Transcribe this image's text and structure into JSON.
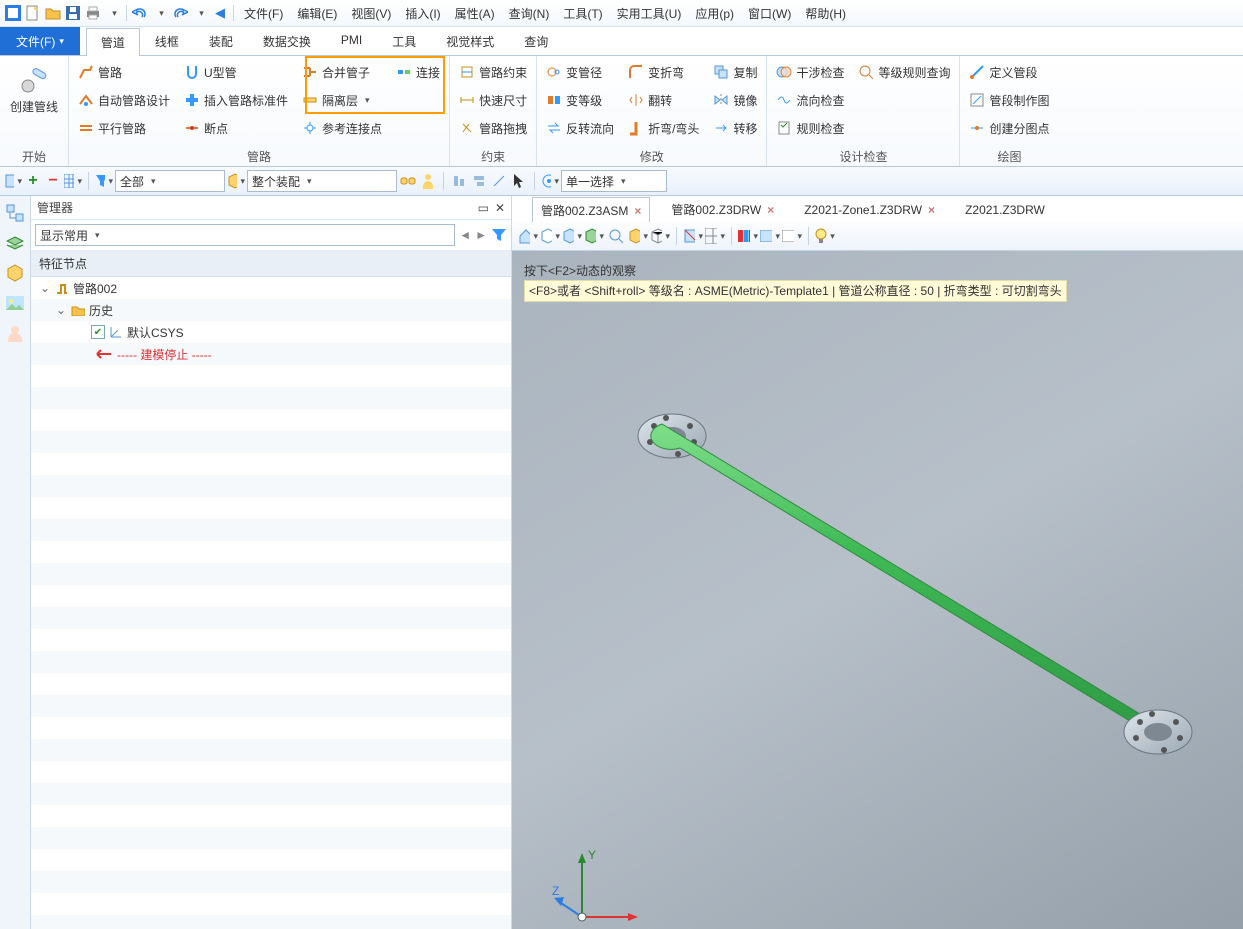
{
  "qa_menus": [
    "文件(F)",
    "编辑(E)",
    "视图(V)",
    "插入(I)",
    "属性(A)",
    "查询(N)",
    "工具(T)",
    "实用工具(U)",
    "应用(p)",
    "窗口(W)",
    "帮助(H)"
  ],
  "file_tab": "文件(F)",
  "ribbon_tabs": [
    "管道",
    "线框",
    "装配",
    "数据交换",
    "PMI",
    "工具",
    "视觉样式",
    "查询"
  ],
  "active_ribbon_tab": 0,
  "groups": {
    "start": {
      "label": "开始",
      "big": "创建管线"
    },
    "route": {
      "label": "管路",
      "col1": [
        "管路",
        "自动管路设计",
        "平行管路"
      ],
      "col2": [
        "U型管",
        "插入管路标准件",
        "断点"
      ],
      "col3": [
        "合并管子",
        "隔离层",
        "参考连接点"
      ],
      "col4": [
        "连接"
      ]
    },
    "constraint": {
      "label": "约束",
      "items": [
        "管路约束",
        "快速尺寸",
        "管路拖拽"
      ]
    },
    "modify": {
      "label": "修改",
      "col1": [
        "变管径",
        "变等级",
        "反转流向"
      ],
      "col2": [
        "变折弯",
        "翻转",
        "折弯/弯头"
      ],
      "col3": [
        "复制",
        "镜像",
        "转移"
      ]
    },
    "check": {
      "label": "设计检查",
      "col1": [
        "干涉检查",
        "流向检查",
        "规则检查"
      ],
      "col2": [
        "等级规则查询"
      ]
    },
    "draw": {
      "label": "绘图",
      "items": [
        "定义管段",
        "管段制作图",
        "创建分图点"
      ]
    }
  },
  "tb2": {
    "filter1": "全部",
    "filter2": "整个装配",
    "select_mode": "单一选择"
  },
  "manager": {
    "title": "管理器",
    "display": "显示常用",
    "feature_header": "特征节点",
    "root": "管路002",
    "history": "历史",
    "csys": "默认CSYS",
    "stop": "----- 建模停止 -----"
  },
  "doc_tabs": [
    {
      "label": "管路002.Z3ASM",
      "active": true
    },
    {
      "label": "管路002.Z3DRW",
      "active": false
    },
    {
      "label": "Z2021-Zone1.Z3DRW",
      "active": false
    },
    {
      "label": "Z2021.Z3DRW",
      "active": false
    }
  ],
  "hint": {
    "l1": "按下<F2>动态的观察",
    "l2": "<F8>或者 <Shift+roll> 等级名 : ASME(Metric)-Template1 | 管道公称直径 : 50 | 折弯类型 : 可切割弯头"
  }
}
